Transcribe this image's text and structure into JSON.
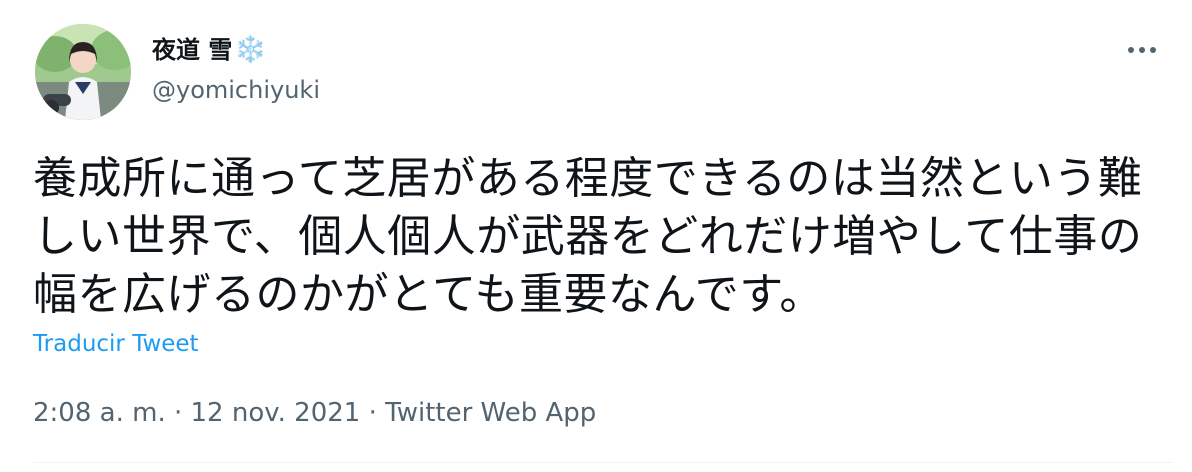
{
  "author": {
    "display_name": "夜道 雪",
    "name_emoji": "❄️",
    "handle": "@yomichiyuki"
  },
  "tweet": {
    "text": "養成所に通って芝居がある程度できるのは当然という難しい世界で、個人個人が武器をどれだけ増やして仕事の幅を広げるのかがとても重要なんです。",
    "translate_label": "Traducir Tweet"
  },
  "meta": {
    "time": "2:08 a. m.",
    "separator": " · ",
    "date": "12 nov. 2021",
    "source": "Twitter Web App"
  },
  "icons": {
    "more": "more-horizontal-icon",
    "avatar": "avatar-photo"
  },
  "colors": {
    "link": "#1d9bf0",
    "secondary_text": "#536471",
    "primary_text": "#0f1419",
    "snowflake": "#5ab4ea"
  }
}
